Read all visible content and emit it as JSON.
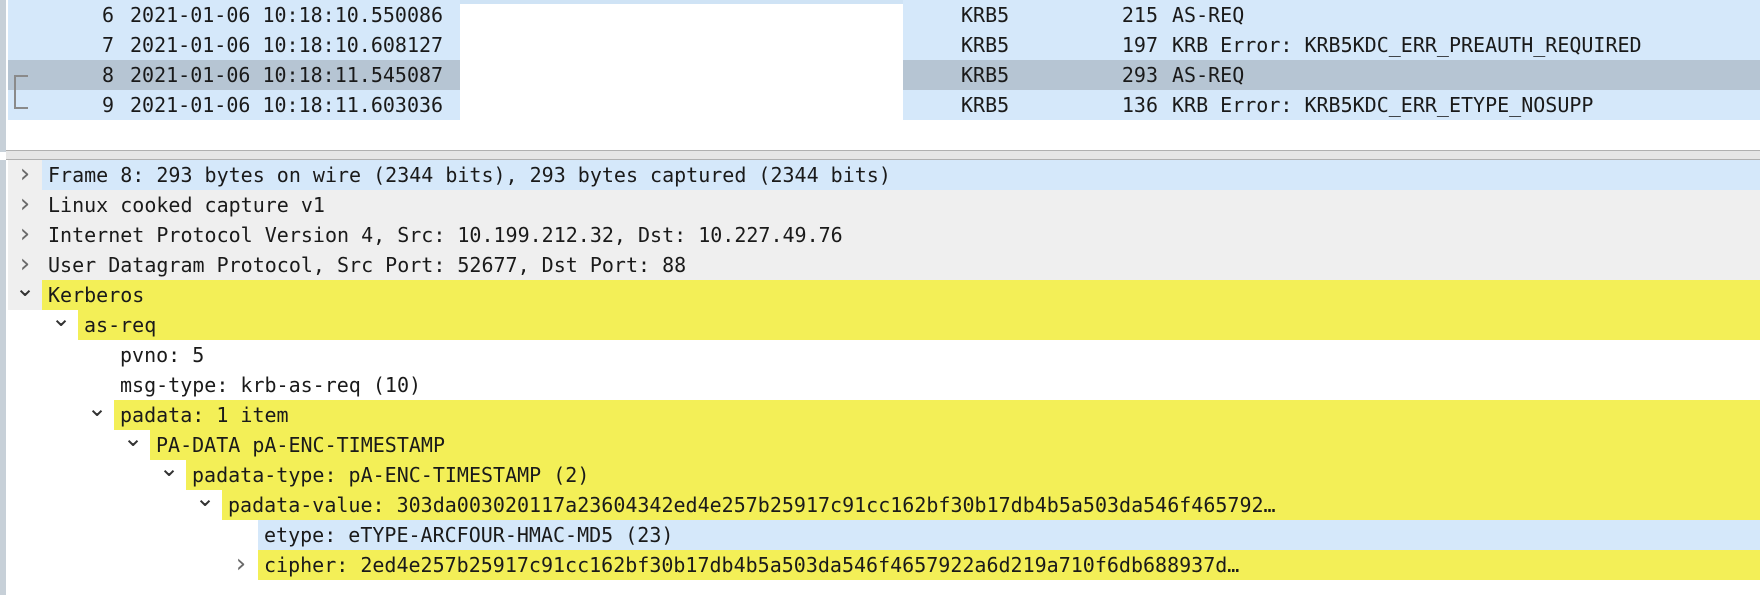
{
  "packet_list": {
    "rows": [
      {
        "no": "6",
        "time": "2021-01-06 10:18:10.550086",
        "protocol": "KRB5",
        "length": "215",
        "info": "AS-REQ",
        "state": "light"
      },
      {
        "no": "7",
        "time": "2021-01-06 10:18:10.608127",
        "protocol": "KRB5",
        "length": "197",
        "info": "KRB Error: KRB5KDC_ERR_PREAUTH_REQUIRED",
        "state": "light"
      },
      {
        "no": "8",
        "time": "2021-01-06 10:18:11.545087",
        "protocol": "KRB5",
        "length": "293",
        "info": "AS-REQ",
        "state": "selected"
      },
      {
        "no": "9",
        "time": "2021-01-06 10:18:11.603036",
        "protocol": "KRB5",
        "length": "136",
        "info": "KRB Error: KRB5KDC_ERR_ETYPE_NOSUPP",
        "state": "light"
      }
    ]
  },
  "details": {
    "rows": [
      {
        "text": "Frame 8: 293 bytes on wire (2344 bits), 293 bytes captured (2344 bits)",
        "level": 0,
        "expander": "collapsed",
        "style": "sel"
      },
      {
        "text": "Linux cooked capture v1",
        "level": 0,
        "expander": "collapsed",
        "style": "plain"
      },
      {
        "text": "Internet Protocol Version 4, Src: 10.199.212.32, Dst: 10.227.49.76",
        "level": 0,
        "expander": "collapsed",
        "style": "plain"
      },
      {
        "text": "User Datagram Protocol, Src Port: 52677, Dst Port: 88",
        "level": 0,
        "expander": "collapsed",
        "style": "plain"
      },
      {
        "text": "Kerberos",
        "level": 0,
        "expander": "expanded",
        "style": "hl"
      },
      {
        "text": "as-req",
        "level": 1,
        "expander": "expanded",
        "style": "hl"
      },
      {
        "text": "pvno: 5",
        "level": 2,
        "expander": "none",
        "style": "white"
      },
      {
        "text": "msg-type: krb-as-req (10)",
        "level": 2,
        "expander": "none",
        "style": "white"
      },
      {
        "text": "padata: 1 item",
        "level": 2,
        "expander": "expanded",
        "style": "hl"
      },
      {
        "text": "PA-DATA pA-ENC-TIMESTAMP",
        "level": 3,
        "expander": "expanded",
        "style": "hl"
      },
      {
        "text": "padata-type: pA-ENC-TIMESTAMP (2)",
        "level": 4,
        "expander": "expanded",
        "style": "hl"
      },
      {
        "text": "padata-value: 303da003020117a23604342ed4e257b25917c91cc162bf30b17db4b5a503da546f465792…",
        "level": 5,
        "expander": "expanded",
        "style": "hl"
      },
      {
        "text": "etype: eTYPE-ARCFOUR-HMAC-MD5 (23)",
        "level": 6,
        "expander": "none",
        "style": "blue"
      },
      {
        "text": "cipher: 2ed4e257b25917c91cc162bf30b17db4b5a503da546f4657922a6d219a710f6db688937d…",
        "level": 6,
        "expander": "collapsed",
        "style": "hl"
      }
    ]
  },
  "colors": {
    "selected_row": "#b6c5d3",
    "light_row": "#d5e8fa",
    "highlight": "#f3ef57",
    "plain_row": "#efefef"
  }
}
